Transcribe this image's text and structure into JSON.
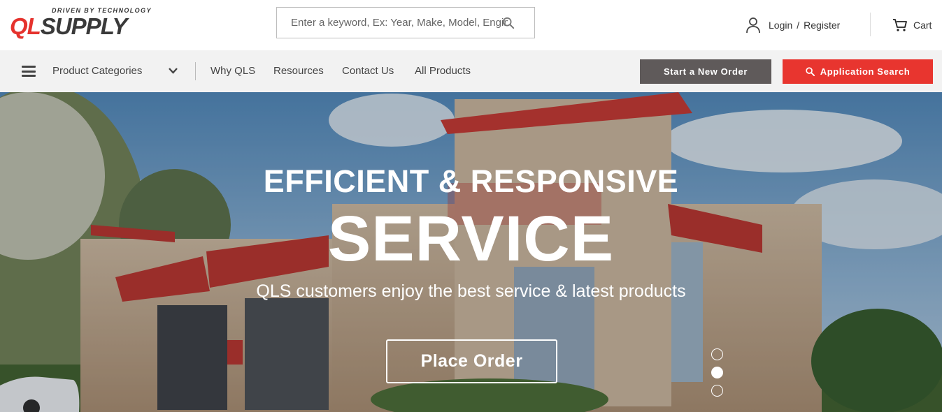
{
  "header": {
    "logo": {
      "tagline": "DRIVEN BY TECHNOLOGY",
      "brand_ql": "QL",
      "brand_supply": "SUPPLY"
    },
    "search": {
      "placeholder": "Enter a keyword, Ex: Year, Make, Model, Engine"
    },
    "login": {
      "login_label": "Login",
      "separator": "/",
      "register_label": "Register"
    },
    "cart_label": "Cart"
  },
  "nav": {
    "categories_label": "Product Categories",
    "links": [
      "Why QLS",
      "Resources",
      "Contact Us",
      "All Products"
    ],
    "start_order_label": "Start a New Order",
    "application_search_label": "Application Search"
  },
  "hero": {
    "headline": "EFFICIENT & RESPONSIVE",
    "title": "SERVICE",
    "subtitle": "QLS customers enjoy the best service & latest products",
    "cta_label": "Place Order",
    "slide_count": 3,
    "active_slide": 2
  },
  "colors": {
    "brand_red": "#e8352f",
    "dark_button": "#5f5a5a",
    "nav_bg": "#f2f2f2"
  }
}
